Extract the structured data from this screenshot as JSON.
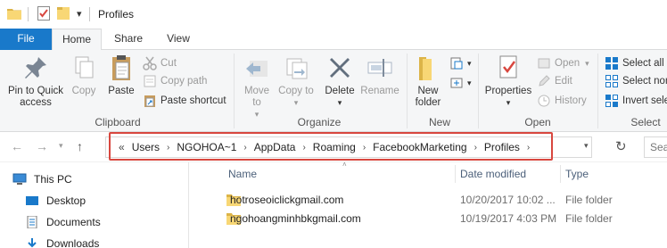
{
  "window": {
    "title": "Profiles"
  },
  "quick_access": {
    "dropdown_glyph": "▾",
    "icons": [
      "folder-icon",
      "properties-icon",
      "new-folder-icon"
    ]
  },
  "tabs": [
    {
      "label": "File"
    },
    {
      "label": "Home"
    },
    {
      "label": "Share"
    },
    {
      "label": "View"
    }
  ],
  "ribbon": {
    "clipboard": {
      "label": "Clipboard",
      "pin_label": "Pin to Quick access",
      "copy_label": "Copy",
      "paste_label": "Paste",
      "cut_label": "Cut",
      "copy_path_label": "Copy path",
      "paste_shortcut_label": "Paste shortcut"
    },
    "organize": {
      "label": "Organize",
      "move_to_label": "Move to",
      "copy_to_label": "Copy to",
      "delete_label": "Delete",
      "rename_label": "Rename"
    },
    "new": {
      "label": "New",
      "new_folder_label": "New folder"
    },
    "open": {
      "label": "Open",
      "properties_label": "Properties",
      "open_label": "Open",
      "edit_label": "Edit",
      "history_label": "History"
    },
    "select": {
      "label": "Select",
      "select_all_label": "Select all",
      "select_none_label": "Select non",
      "invert_label": "Invert sele"
    }
  },
  "addressbar": {
    "overflow": "«",
    "crumbs": [
      "Users",
      "NGOHOA~1",
      "AppData",
      "Roaming",
      "FacebookMarketing",
      "Profiles"
    ],
    "search_placeholder": "Sea"
  },
  "navpane": {
    "items": [
      {
        "label": "This PC",
        "icon": "computer-icon"
      },
      {
        "label": "Desktop",
        "icon": "desktop-icon"
      },
      {
        "label": "Documents",
        "icon": "documents-icon"
      },
      {
        "label": "Downloads",
        "icon": "downloads-icon"
      }
    ]
  },
  "filelist": {
    "columns": {
      "name": "Name",
      "date": "Date modified",
      "type": "Type"
    },
    "rows": [
      {
        "name": "hotroseoiclickgmail.com",
        "date": "10/20/2017 10:02 ...",
        "type": "File folder"
      },
      {
        "name": "ngohoangminhbkgmail.com",
        "date": "10/19/2017 4:03 PM",
        "type": "File folder"
      }
    ]
  },
  "colors": {
    "accent": "#1979ca",
    "highlight": "#d8473f",
    "folder": "#f8d775"
  }
}
